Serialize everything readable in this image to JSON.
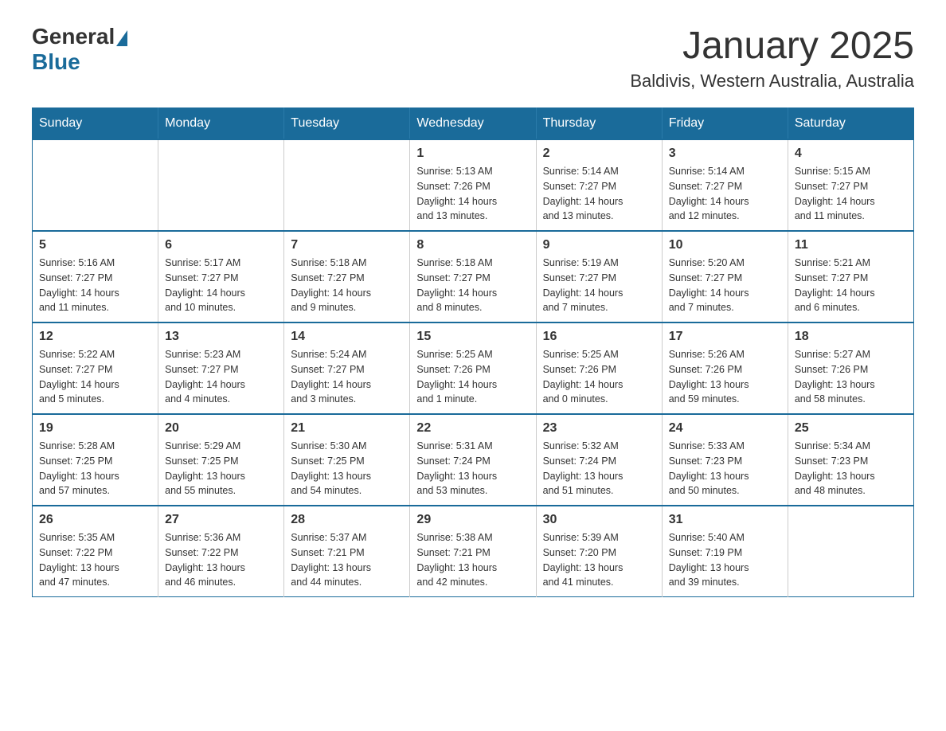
{
  "logo": {
    "general": "General",
    "blue": "Blue"
  },
  "header": {
    "title": "January 2025",
    "subtitle": "Baldivis, Western Australia, Australia"
  },
  "days_of_week": [
    "Sunday",
    "Monday",
    "Tuesday",
    "Wednesday",
    "Thursday",
    "Friday",
    "Saturday"
  ],
  "weeks": [
    [
      {
        "day": "",
        "info": ""
      },
      {
        "day": "",
        "info": ""
      },
      {
        "day": "",
        "info": ""
      },
      {
        "day": "1",
        "info": "Sunrise: 5:13 AM\nSunset: 7:26 PM\nDaylight: 14 hours\nand 13 minutes."
      },
      {
        "day": "2",
        "info": "Sunrise: 5:14 AM\nSunset: 7:27 PM\nDaylight: 14 hours\nand 13 minutes."
      },
      {
        "day": "3",
        "info": "Sunrise: 5:14 AM\nSunset: 7:27 PM\nDaylight: 14 hours\nand 12 minutes."
      },
      {
        "day": "4",
        "info": "Sunrise: 5:15 AM\nSunset: 7:27 PM\nDaylight: 14 hours\nand 11 minutes."
      }
    ],
    [
      {
        "day": "5",
        "info": "Sunrise: 5:16 AM\nSunset: 7:27 PM\nDaylight: 14 hours\nand 11 minutes."
      },
      {
        "day": "6",
        "info": "Sunrise: 5:17 AM\nSunset: 7:27 PM\nDaylight: 14 hours\nand 10 minutes."
      },
      {
        "day": "7",
        "info": "Sunrise: 5:18 AM\nSunset: 7:27 PM\nDaylight: 14 hours\nand 9 minutes."
      },
      {
        "day": "8",
        "info": "Sunrise: 5:18 AM\nSunset: 7:27 PM\nDaylight: 14 hours\nand 8 minutes."
      },
      {
        "day": "9",
        "info": "Sunrise: 5:19 AM\nSunset: 7:27 PM\nDaylight: 14 hours\nand 7 minutes."
      },
      {
        "day": "10",
        "info": "Sunrise: 5:20 AM\nSunset: 7:27 PM\nDaylight: 14 hours\nand 7 minutes."
      },
      {
        "day": "11",
        "info": "Sunrise: 5:21 AM\nSunset: 7:27 PM\nDaylight: 14 hours\nand 6 minutes."
      }
    ],
    [
      {
        "day": "12",
        "info": "Sunrise: 5:22 AM\nSunset: 7:27 PM\nDaylight: 14 hours\nand 5 minutes."
      },
      {
        "day": "13",
        "info": "Sunrise: 5:23 AM\nSunset: 7:27 PM\nDaylight: 14 hours\nand 4 minutes."
      },
      {
        "day": "14",
        "info": "Sunrise: 5:24 AM\nSunset: 7:27 PM\nDaylight: 14 hours\nand 3 minutes."
      },
      {
        "day": "15",
        "info": "Sunrise: 5:25 AM\nSunset: 7:26 PM\nDaylight: 14 hours\nand 1 minute."
      },
      {
        "day": "16",
        "info": "Sunrise: 5:25 AM\nSunset: 7:26 PM\nDaylight: 14 hours\nand 0 minutes."
      },
      {
        "day": "17",
        "info": "Sunrise: 5:26 AM\nSunset: 7:26 PM\nDaylight: 13 hours\nand 59 minutes."
      },
      {
        "day": "18",
        "info": "Sunrise: 5:27 AM\nSunset: 7:26 PM\nDaylight: 13 hours\nand 58 minutes."
      }
    ],
    [
      {
        "day": "19",
        "info": "Sunrise: 5:28 AM\nSunset: 7:25 PM\nDaylight: 13 hours\nand 57 minutes."
      },
      {
        "day": "20",
        "info": "Sunrise: 5:29 AM\nSunset: 7:25 PM\nDaylight: 13 hours\nand 55 minutes."
      },
      {
        "day": "21",
        "info": "Sunrise: 5:30 AM\nSunset: 7:25 PM\nDaylight: 13 hours\nand 54 minutes."
      },
      {
        "day": "22",
        "info": "Sunrise: 5:31 AM\nSunset: 7:24 PM\nDaylight: 13 hours\nand 53 minutes."
      },
      {
        "day": "23",
        "info": "Sunrise: 5:32 AM\nSunset: 7:24 PM\nDaylight: 13 hours\nand 51 minutes."
      },
      {
        "day": "24",
        "info": "Sunrise: 5:33 AM\nSunset: 7:23 PM\nDaylight: 13 hours\nand 50 minutes."
      },
      {
        "day": "25",
        "info": "Sunrise: 5:34 AM\nSunset: 7:23 PM\nDaylight: 13 hours\nand 48 minutes."
      }
    ],
    [
      {
        "day": "26",
        "info": "Sunrise: 5:35 AM\nSunset: 7:22 PM\nDaylight: 13 hours\nand 47 minutes."
      },
      {
        "day": "27",
        "info": "Sunrise: 5:36 AM\nSunset: 7:22 PM\nDaylight: 13 hours\nand 46 minutes."
      },
      {
        "day": "28",
        "info": "Sunrise: 5:37 AM\nSunset: 7:21 PM\nDaylight: 13 hours\nand 44 minutes."
      },
      {
        "day": "29",
        "info": "Sunrise: 5:38 AM\nSunset: 7:21 PM\nDaylight: 13 hours\nand 42 minutes."
      },
      {
        "day": "30",
        "info": "Sunrise: 5:39 AM\nSunset: 7:20 PM\nDaylight: 13 hours\nand 41 minutes."
      },
      {
        "day": "31",
        "info": "Sunrise: 5:40 AM\nSunset: 7:19 PM\nDaylight: 13 hours\nand 39 minutes."
      },
      {
        "day": "",
        "info": ""
      }
    ]
  ]
}
